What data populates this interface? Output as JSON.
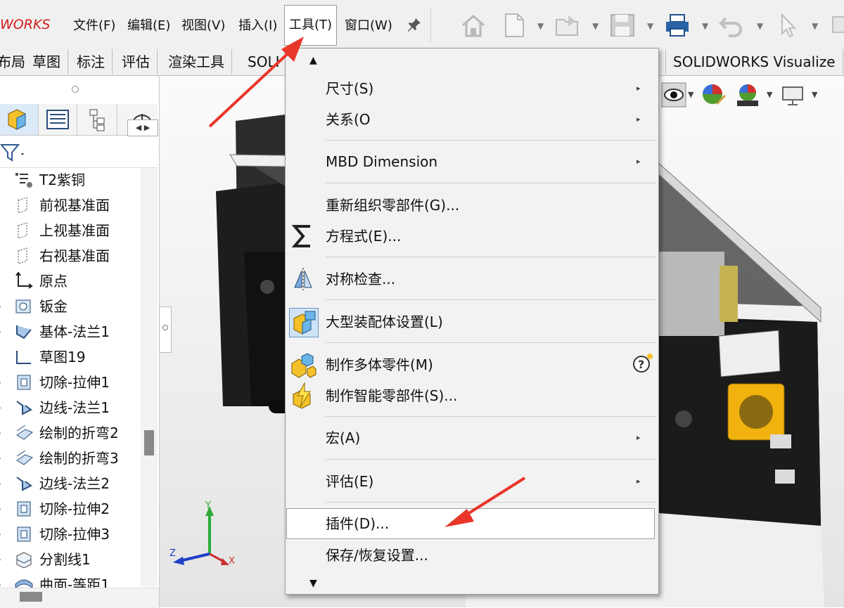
{
  "app": {
    "logo": "WORKS"
  },
  "menubar": {
    "items": [
      "文件(F)",
      "编辑(E)",
      "视图(V)",
      "插入(I)",
      "工具(T)",
      "窗口(W)"
    ]
  },
  "tabs": [
    "布局",
    "草图",
    "标注",
    "评估",
    "渲染工具",
    "SOLI",
    "SOLIDWORKS Visualize"
  ],
  "tree": [
    {
      "label": "T2紫铜",
      "icon": "material-icon",
      "expand": false
    },
    {
      "label": "前视基准面",
      "icon": "plane-icon",
      "expand": false
    },
    {
      "label": "上视基准面",
      "icon": "plane-icon",
      "expand": false
    },
    {
      "label": "右视基准面",
      "icon": "plane-icon",
      "expand": false
    },
    {
      "label": "原点",
      "icon": "origin-icon",
      "expand": false
    },
    {
      "label": "钣金",
      "icon": "sheetmetal-icon",
      "expand": true
    },
    {
      "label": "基体-法兰1",
      "icon": "base-flange-icon",
      "expand": true
    },
    {
      "label": "草图19",
      "icon": "sketch-icon",
      "expand": false
    },
    {
      "label": "切除-拉伸1",
      "icon": "cut-extrude-icon",
      "expand": true
    },
    {
      "label": "边线-法兰1",
      "icon": "edge-flange-icon",
      "expand": true
    },
    {
      "label": "绘制的折弯2",
      "icon": "sketched-bend-icon",
      "expand": true
    },
    {
      "label": "绘制的折弯3",
      "icon": "sketched-bend-icon",
      "expand": true
    },
    {
      "label": "边线-法兰2",
      "icon": "edge-flange-icon",
      "expand": true
    },
    {
      "label": "切除-拉伸2",
      "icon": "cut-extrude-icon",
      "expand": true
    },
    {
      "label": "切除-拉伸3",
      "icon": "cut-extrude-icon",
      "expand": true
    },
    {
      "label": "分割线1",
      "icon": "split-line-icon",
      "expand": true
    },
    {
      "label": "曲面-等距1",
      "icon": "offset-surface-icon",
      "expand": true
    }
  ],
  "dropdown": {
    "items": [
      {
        "label": "尺寸(S)",
        "submenu": true
      },
      {
        "label": "关系(O",
        "submenu": true
      },
      {
        "label": "MBD Dimension",
        "submenu": true
      },
      {
        "label": "重新组织零部件(G)...",
        "submenu": false
      },
      {
        "label": "方程式(E)...",
        "submenu": false,
        "icon": "sigma-icon"
      },
      {
        "label": "对称检查...",
        "submenu": false,
        "icon": "symmetry-icon"
      },
      {
        "label": "大型装配体设置(L)",
        "submenu": false,
        "icon": "large-assembly-icon"
      },
      {
        "label": "制作多体零件(M)",
        "submenu": false,
        "icon": "multibody-icon"
      },
      {
        "label": "制作智能零部件(S)...",
        "submenu": false,
        "icon": "smart-component-icon"
      },
      {
        "label": "宏(A)",
        "submenu": true
      },
      {
        "label": "评估(E)",
        "submenu": true
      },
      {
        "label": "插件(D)...",
        "submenu": false,
        "highlighted": true
      },
      {
        "label": "保存/恢复设置...",
        "submenu": false
      }
    ]
  },
  "triad": {
    "x": "X",
    "y": "Y",
    "z": "Z"
  },
  "colors": {
    "accent_red": "#e8372a",
    "logo_red": "#d41c1c"
  }
}
